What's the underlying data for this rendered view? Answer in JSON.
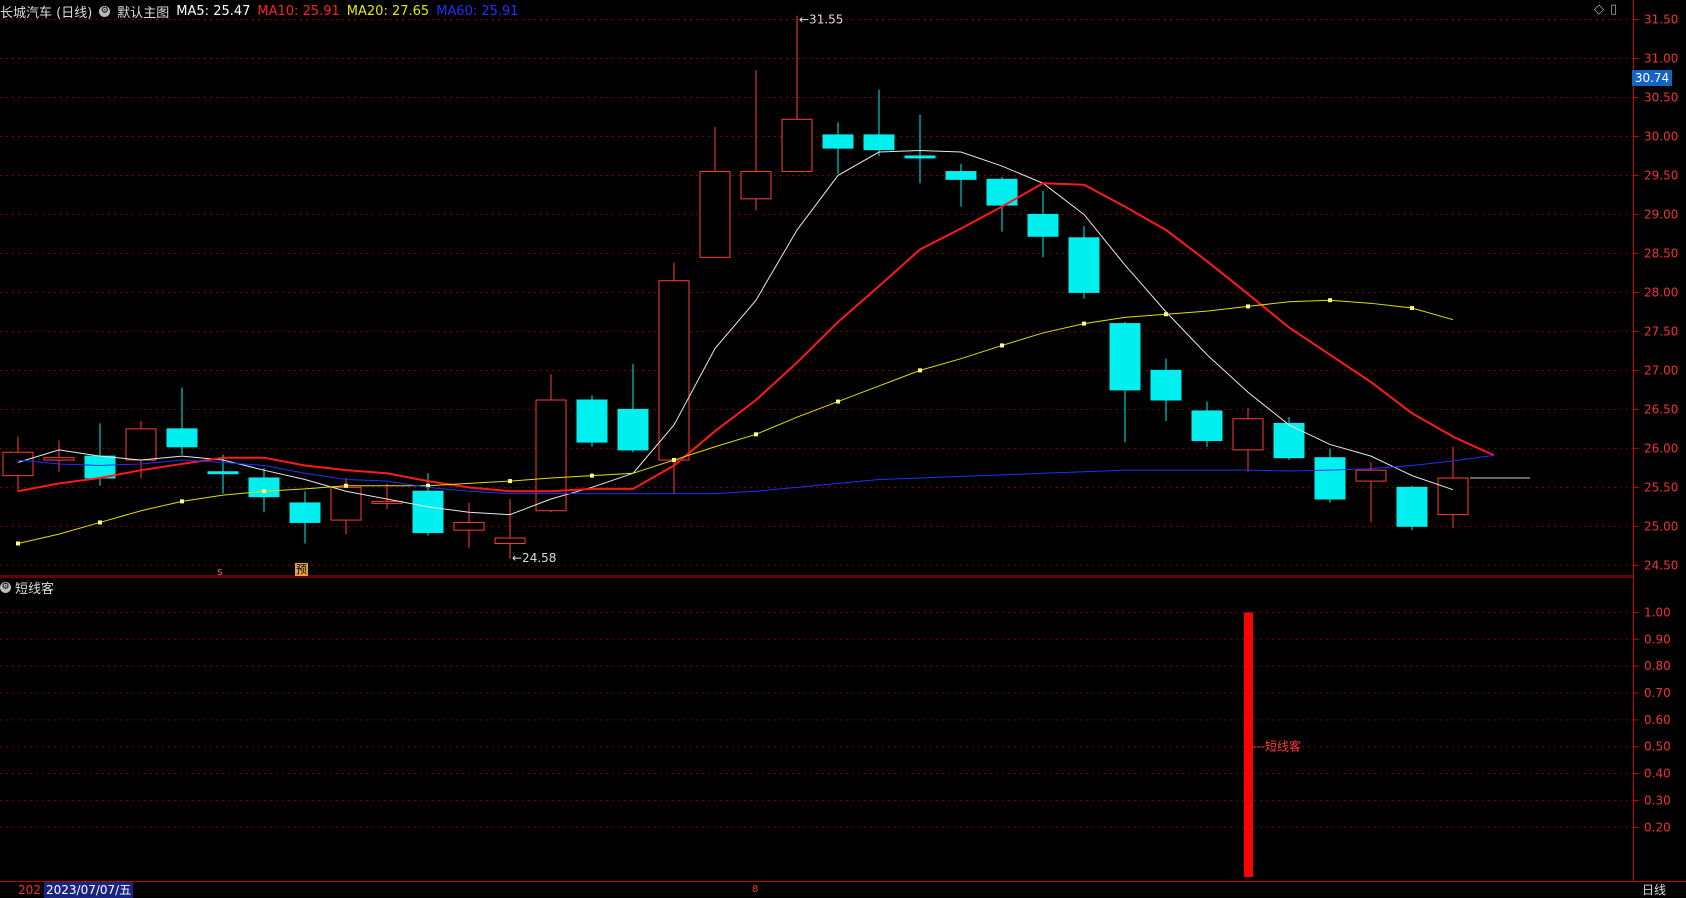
{
  "header": {
    "stock_title": "长城汽车 (日线)",
    "template_name": "默认主图",
    "ma5_label": "MA5: 25.47",
    "ma10_label": "MA10: 25.91",
    "ma20_label": "MA20: 27.65",
    "ma60_label": "MA60: 25.91",
    "colors": {
      "ma5": "#ffffff",
      "ma10": "#ff2020",
      "ma20": "#e8e800",
      "ma60": "#2030ff"
    }
  },
  "current_price_tag": "30.74",
  "sub_panel": {
    "title": "短线客",
    "signal_label": "短线客"
  },
  "footer": {
    "date_prefix": "202",
    "selected_date": "2023/07/07/五",
    "period": "日线",
    "tick_mark": "8"
  },
  "markers": {
    "s": "s",
    "yu": "预"
  },
  "chart_data": [
    {
      "type": "candlestick",
      "title": "长城汽车 (日线)",
      "y_ticks": [
        "31.50",
        "31.00",
        "30.50",
        "30.00",
        "29.50",
        "29.00",
        "28.50",
        "28.00",
        "27.50",
        "27.00",
        "26.50",
        "26.00",
        "25.50",
        "25.00",
        "24.50"
      ],
      "ylim": [
        24.35,
        31.75
      ],
      "grid": true,
      "annotations": [
        {
          "text": "31.55",
          "candle": 19
        },
        {
          "text": "24.58",
          "candle": 12
        }
      ],
      "candles": [
        {
          "o": 25.65,
          "c": 25.95,
          "h": 26.15,
          "l": 25.45
        },
        {
          "o": 25.85,
          "c": 25.88,
          "h": 26.1,
          "l": 25.7
        },
        {
          "o": 25.9,
          "c": 25.62,
          "h": 26.32,
          "l": 25.52
        },
        {
          "o": 25.85,
          "c": 26.25,
          "h": 26.35,
          "l": 25.62
        },
        {
          "o": 26.25,
          "c": 26.02,
          "h": 26.78,
          "l": 25.92
        },
        {
          "o": 25.7,
          "c": 25.68,
          "h": 25.92,
          "l": 25.42
        },
        {
          "o": 25.62,
          "c": 25.38,
          "h": 25.75,
          "l": 25.18
        },
        {
          "o": 25.3,
          "c": 25.05,
          "h": 25.45,
          "l": 24.78
        },
        {
          "o": 25.08,
          "c": 25.5,
          "h": 25.62,
          "l": 24.9
        },
        {
          "o": 25.3,
          "c": 25.32,
          "h": 25.55,
          "l": 25.22
        },
        {
          "o": 25.45,
          "c": 24.92,
          "h": 25.68,
          "l": 24.88
        },
        {
          "o": 24.95,
          "c": 25.05,
          "h": 25.3,
          "l": 24.72
        },
        {
          "o": 24.78,
          "c": 24.85,
          "h": 25.35,
          "l": 24.58
        },
        {
          "o": 25.2,
          "c": 26.62,
          "h": 26.95,
          "l": 25.18
        },
        {
          "o": 26.62,
          "c": 26.08,
          "h": 26.68,
          "l": 26.02
        },
        {
          "o": 26.5,
          "c": 25.98,
          "h": 27.08,
          "l": 25.95
        },
        {
          "o": 25.85,
          "c": 28.15,
          "h": 28.38,
          "l": 25.42
        },
        {
          "o": 28.45,
          "c": 29.55,
          "h": 30.12,
          "l": 28.45
        },
        {
          "o": 29.2,
          "c": 29.55,
          "h": 30.85,
          "l": 29.05
        },
        {
          "o": 29.55,
          "c": 30.22,
          "h": 31.55,
          "l": 29.55
        },
        {
          "o": 30.02,
          "c": 29.85,
          "h": 30.18,
          "l": 29.52
        },
        {
          "o": 30.02,
          "c": 29.83,
          "h": 30.6,
          "l": 29.75
        },
        {
          "o": 29.75,
          "c": 29.73,
          "h": 30.28,
          "l": 29.4
        },
        {
          "o": 29.55,
          "c": 29.45,
          "h": 29.65,
          "l": 29.1
        },
        {
          "o": 29.45,
          "c": 29.12,
          "h": 29.48,
          "l": 28.78
        },
        {
          "o": 29.0,
          "c": 28.72,
          "h": 29.3,
          "l": 28.45
        },
        {
          "o": 28.7,
          "c": 28.0,
          "h": 28.85,
          "l": 27.92
        },
        {
          "o": 27.6,
          "c": 26.75,
          "h": 27.62,
          "l": 26.08
        },
        {
          "o": 27.0,
          "c": 26.62,
          "h": 27.15,
          "l": 26.35
        },
        {
          "o": 26.48,
          "c": 26.1,
          "h": 26.6,
          "l": 26.02
        },
        {
          "o": 25.98,
          "c": 26.38,
          "h": 26.52,
          "l": 25.7
        },
        {
          "o": 26.32,
          "c": 25.88,
          "h": 26.4,
          "l": 25.85
        },
        {
          "o": 25.88,
          "c": 25.35,
          "h": 26.0,
          "l": 25.3
        },
        {
          "o": 25.58,
          "c": 25.72,
          "h": 25.82,
          "l": 25.05
        },
        {
          "o": 25.5,
          "c": 25.0,
          "h": 25.52,
          "l": 24.95
        },
        {
          "o": 25.15,
          "c": 25.62,
          "h": 26.02,
          "l": 24.98
        }
      ],
      "series": [
        {
          "name": "MA5",
          "values": [
            25.82,
            25.98,
            25.9,
            25.85,
            25.9,
            25.85,
            25.72,
            25.6,
            25.45,
            25.35,
            25.25,
            25.18,
            25.15,
            25.35,
            25.5,
            25.68,
            26.3,
            27.28,
            27.9,
            28.8,
            29.5,
            29.8,
            29.82,
            29.8,
            29.62,
            29.4,
            29.0,
            28.35,
            27.75,
            27.2,
            26.72,
            26.3,
            26.05,
            25.9,
            25.65,
            25.47
          ]
        },
        {
          "name": "MA10",
          "values": [
            25.45,
            25.55,
            25.62,
            25.72,
            25.8,
            25.88,
            25.88,
            25.78,
            25.72,
            25.68,
            25.58,
            25.5,
            25.45,
            25.45,
            25.48,
            25.48,
            25.78,
            26.22,
            26.62,
            27.1,
            27.62,
            28.08,
            28.55,
            28.82,
            29.1,
            29.4,
            29.38,
            29.1,
            28.8,
            28.4,
            27.98,
            27.55,
            27.2,
            26.85,
            26.45,
            26.15,
            25.91
          ]
        },
        {
          "name": "MA20",
          "values": [
            24.78,
            24.9,
            25.05,
            25.2,
            25.32,
            25.4,
            25.45,
            25.48,
            25.52,
            25.52,
            25.52,
            25.55,
            25.58,
            25.62,
            25.65,
            25.68,
            25.85,
            26.02,
            26.18,
            26.4,
            26.6,
            26.8,
            27.0,
            27.15,
            27.32,
            27.48,
            27.6,
            27.68,
            27.72,
            27.76,
            27.82,
            27.88,
            27.9,
            27.86,
            27.8,
            27.65
          ]
        },
        {
          "name": "MA60",
          "values": [
            25.85,
            25.8,
            25.78,
            25.8,
            25.85,
            25.82,
            25.78,
            25.68,
            25.6,
            25.58,
            25.5,
            25.45,
            25.42,
            25.42,
            25.42,
            25.42,
            25.42,
            25.42,
            25.45,
            25.5,
            25.55,
            25.6,
            25.62,
            25.64,
            25.66,
            25.68,
            25.7,
            25.72,
            25.72,
            25.72,
            25.72,
            25.71,
            25.72,
            25.74,
            25.78,
            25.84,
            25.91
          ]
        }
      ]
    },
    {
      "type": "bar",
      "title": "短线客",
      "y_ticks": [
        "1.00",
        "0.90",
        "0.80",
        "0.70",
        "0.60",
        "0.50",
        "0.40",
        "0.30",
        "0.20"
      ],
      "ylim": [
        0,
        1.05
      ],
      "grid": true,
      "bars": [
        {
          "candle": 30,
          "value": 1.0,
          "label": "短线客"
        }
      ]
    }
  ]
}
